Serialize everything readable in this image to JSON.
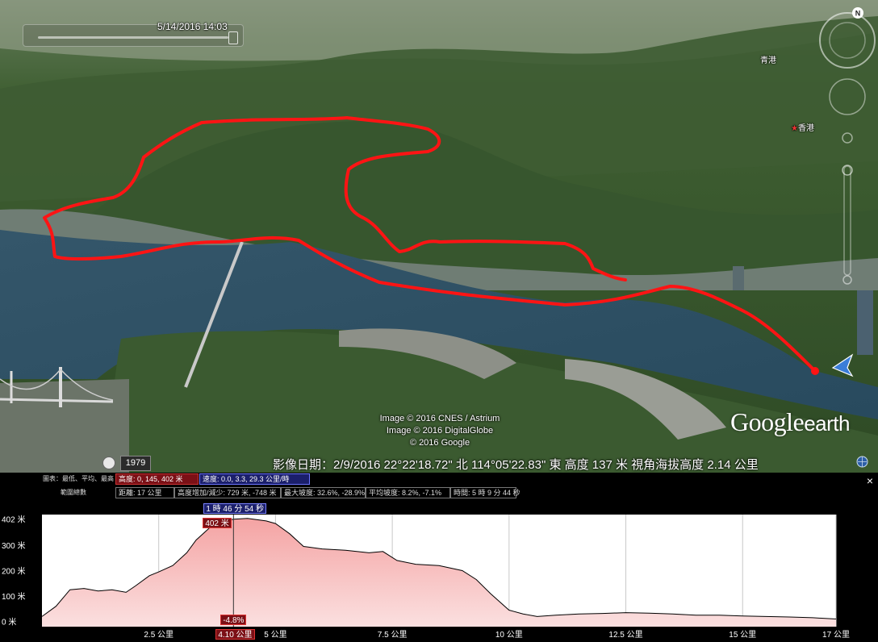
{
  "map": {
    "timestamp": "5/14/2016  14:03",
    "credits": [
      "Image © 2016 CNES / Astrium",
      "Image © 2016 DigitalGlobe",
      "© 2016 Google"
    ],
    "logo_google": "Google",
    "logo_earth": "earth",
    "place_label": "香港",
    "place_label_2": "青港",
    "compass_label": "N",
    "historical_year": "1979",
    "status": "影像日期：2/9/2016     22°22'18.72\" 北  114°05'22.83\" 東  高度    137 米      視角海拔高度    2.14 公里"
  },
  "profile": {
    "row1": {
      "graph_label": "圖表：最低、平均、最高",
      "elevation": "高度: 0, 145, 402 米",
      "speed": "速度: 0.0, 3.3, 29.3 公里/時"
    },
    "row2": {
      "range_label": "範圍總數",
      "distance": "距離: 17 公里",
      "gain_loss": "高度增加/減少: 729 米, -748 米",
      "max_slope": "最大坡度: 32.6%, -28.9%",
      "avg_slope": "平均坡度: 8.2%, -7.1%",
      "time": "時間: 5 時 9 分 44 秒"
    },
    "cursor": {
      "time": "1 時 46 分 54 秒",
      "elevation": "402 米",
      "slope": "-4.8%",
      "distance": "4.10 公里"
    },
    "close_label": "×"
  },
  "chart_data": {
    "type": "area",
    "title": "",
    "xlabel": "",
    "ylabel": "",
    "x_unit": "公里",
    "y_unit": "米",
    "xlim": [
      0,
      17
    ],
    "ylim": [
      -20,
      420
    ],
    "x_ticks": [
      2.5,
      5,
      7.5,
      10,
      12.5,
      15,
      17
    ],
    "x_tick_labels": [
      "2.5 公里",
      "5 公里",
      "7.5 公里",
      "10 公里",
      "12.5 公里",
      "15 公里",
      "17 公里"
    ],
    "y_ticks": [
      0,
      100,
      200,
      300,
      402
    ],
    "y_tick_labels": [
      "0 米",
      "100 米",
      "200 米",
      "300 米",
      "402 米"
    ],
    "cursor_x": 4.1,
    "grid": true,
    "series": [
      {
        "color": "#8b0000",
        "x": [
          0,
          0.3,
          0.6,
          0.9,
          1.2,
          1.5,
          1.8,
          2.0,
          2.3,
          2.5,
          2.8,
          3.1,
          3.3,
          3.6,
          3.9,
          4.1,
          4.4,
          4.8,
          5.0,
          5.3,
          5.6,
          6.0,
          6.5,
          7.0,
          7.3,
          7.6,
          8.0,
          8.5,
          9.0,
          9.3,
          9.6,
          10.0,
          10.3,
          10.6,
          11.0,
          11.5,
          12.0,
          12.5,
          13.0,
          13.5,
          14.0,
          14.5,
          15.0,
          15.5,
          16.0,
          16.5,
          17.0
        ],
        "y": [
          20,
          60,
          125,
          130,
          120,
          125,
          115,
          140,
          180,
          195,
          220,
          270,
          320,
          370,
          395,
          402,
          405,
          395,
          385,
          345,
          295,
          285,
          280,
          270,
          275,
          240,
          225,
          220,
          200,
          165,
          110,
          45,
          30,
          20,
          25,
          30,
          32,
          35,
          33,
          30,
          25,
          25,
          22,
          20,
          18,
          15,
          10
        ]
      }
    ]
  }
}
